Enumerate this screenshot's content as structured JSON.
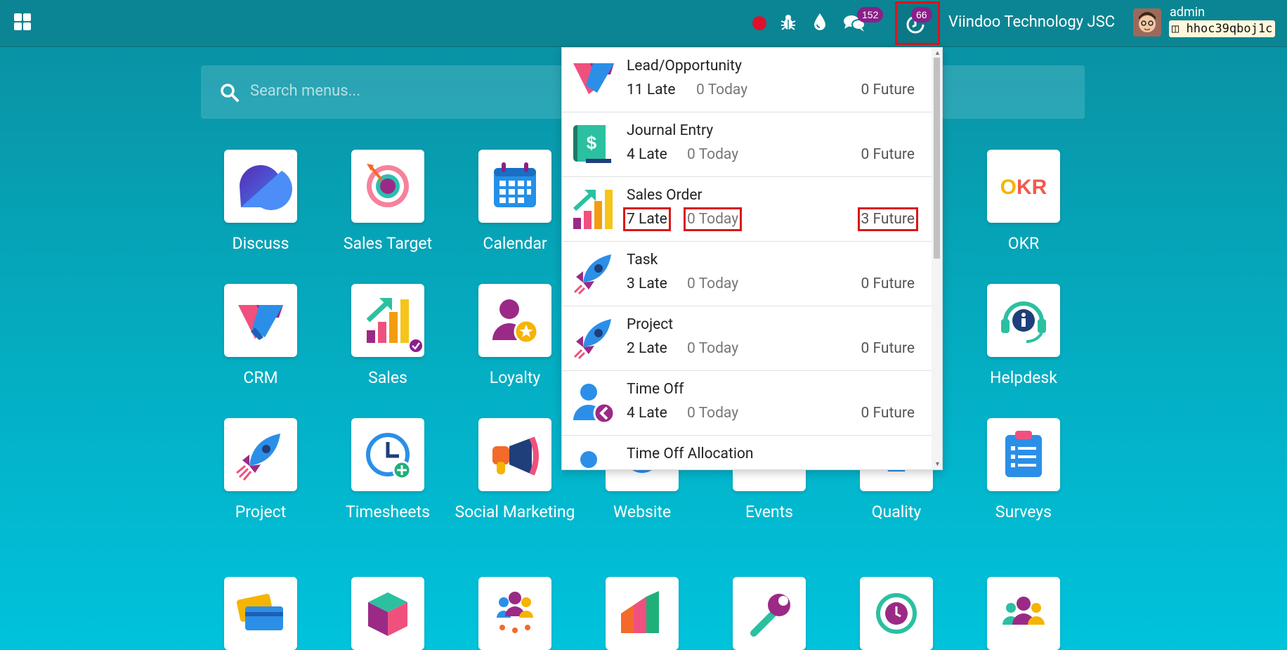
{
  "topbar": {
    "chat_count": "152",
    "activity_count": "66",
    "company": "Viindoo Technology JSC",
    "user": "admin",
    "database": "hhoc39qboj1c"
  },
  "search": {
    "placeholder": "Search menus..."
  },
  "apps": [
    {
      "label": "Discuss"
    },
    {
      "label": "Sales Target"
    },
    {
      "label": "Calendar"
    },
    {
      "label": "OKR"
    },
    {
      "label": "CRM"
    },
    {
      "label": "Sales"
    },
    {
      "label": "Loyalty"
    },
    {
      "label": "Helpdesk"
    },
    {
      "label": "Project"
    },
    {
      "label": "Timesheets"
    },
    {
      "label": "Social Marketing"
    },
    {
      "label": "Website"
    },
    {
      "label": "Events"
    },
    {
      "label": "Quality"
    },
    {
      "label": "Surveys"
    }
  ],
  "activities": [
    {
      "name": "Lead/Opportunity",
      "late": "11 Late",
      "today": "0 Today",
      "future": "0 Future"
    },
    {
      "name": "Journal Entry",
      "late": "4 Late",
      "today": "0 Today",
      "future": "0 Future"
    },
    {
      "name": "Sales Order",
      "late": "7 Late",
      "today": "0 Today",
      "future": "3 Future"
    },
    {
      "name": "Task",
      "late": "3 Late",
      "today": "0 Today",
      "future": "0 Future"
    },
    {
      "name": "Project",
      "late": "2 Late",
      "today": "0 Today",
      "future": "0 Future"
    },
    {
      "name": "Time Off",
      "late": "4 Late",
      "today": "0 Today",
      "future": "0 Future"
    },
    {
      "name": "Time Off Allocation"
    }
  ],
  "colors": {
    "accent": "#0b8593",
    "badge": "#8b1f8a",
    "highlight": "#d81818"
  }
}
